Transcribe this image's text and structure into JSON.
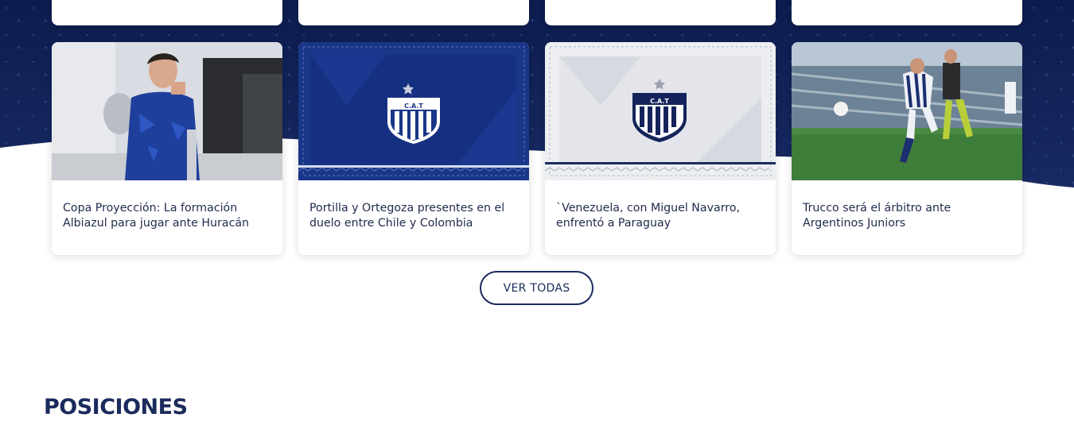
{
  "news": {
    "items": [
      {
        "title": "Copa Proyección: La formación Albiazul para jugar ante Huracán",
        "image": "player-training-photo"
      },
      {
        "title": "Portilla y Ortegoza presentes en el duelo entre Chile y Colombia",
        "image": "club-crest-blue"
      },
      {
        "title": "`Venezuela, con Miguel Navarro, enfrentó a Paraguay",
        "image": "club-crest-white"
      },
      {
        "title": "Trucco será el árbitro ante Argentinos Juniors",
        "image": "match-action-photo"
      }
    ],
    "view_all_label": "VER TODAS"
  },
  "crest": {
    "text": "C.A.T"
  },
  "standings": {
    "title": "POSICIONES"
  },
  "colors": {
    "navy": "#14245a",
    "accent": "#1a2b5c",
    "text": "#1f2a4d"
  }
}
